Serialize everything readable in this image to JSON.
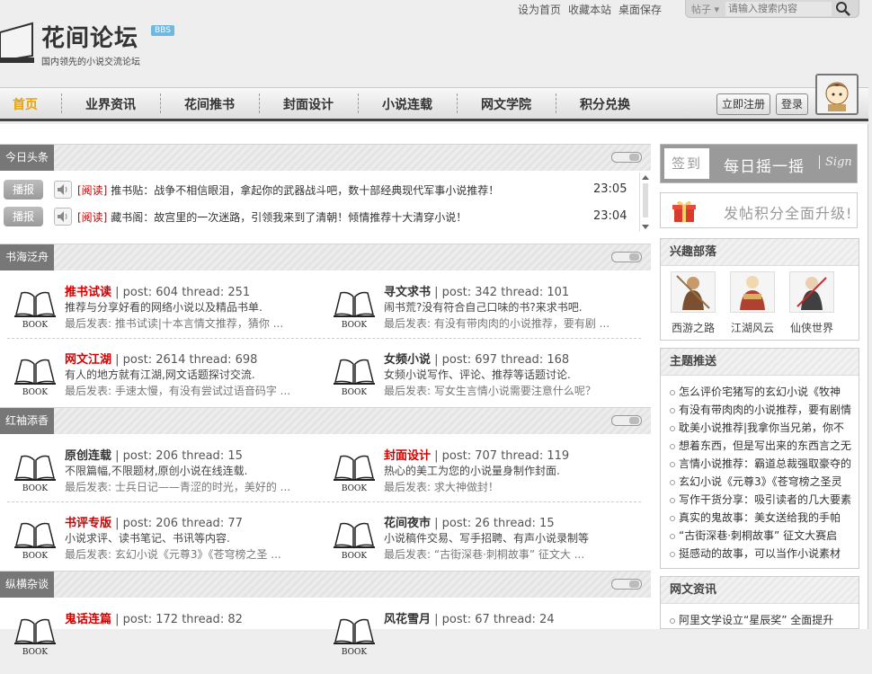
{
  "top_links": [
    "设为首页",
    "收藏本站",
    "桌面保存"
  ],
  "search": {
    "select_label": "帖子",
    "placeholder": "请输入搜索内容"
  },
  "logo": {
    "title": "花间论坛",
    "badge": "BBS",
    "subtitle": "国内领先的小说交流论坛"
  },
  "nav": {
    "items": [
      "首页",
      "业界资讯",
      "花间推书",
      "封面设计",
      "小说连载",
      "网文学院",
      "积分兑换"
    ],
    "active_index": 0
  },
  "auth": {
    "register": "立即注册",
    "login": "登录"
  },
  "headlines": {
    "title": "今日头条",
    "items": [
      {
        "tag": "播报",
        "label": "[阅读]",
        "text": "推书贴：战争不相信眼泪，拿起你的武器战斗吧，数十部经典现代军事小说推荐！",
        "time": "23:05"
      },
      {
        "tag": "播报",
        "label": "[阅读]",
        "text": "藏书阁：故宫里的一次迷路，引领我来到了清朝！倾情推荐十大清穿小说！",
        "time": "23:04"
      }
    ]
  },
  "sections": [
    {
      "title": "书海泛舟",
      "forums": [
        {
          "name": "推书试读",
          "red": true,
          "stats": "| post: 604 thread: 251",
          "desc": "推荐与分享好看的网络小说以及精品书单.",
          "last": "最后发表: 推书试读|十本言情文推荐，猜你 ..."
        },
        {
          "name": "寻文求书",
          "red": false,
          "stats": "| post: 342 thread: 101",
          "desc": "闹书荒?没有符合自己口味的书?来求书吧.",
          "last": "最后发表: 有没有带肉肉的小说推荐，要有剧 ..."
        },
        {
          "name": "网文江湖",
          "red": true,
          "stats": "| post: 2614 thread: 698",
          "desc": "有人的地方就有江湖,网文话题探讨交流.",
          "last": "最后发表: 手速太慢，有没有尝试过语音码字 ..."
        },
        {
          "name": "女频小说",
          "red": false,
          "stats": "| post: 697 thread: 168",
          "desc": "女频小说写作、评论、推荐等话题讨论.",
          "last": "最后发表: 写女生言情小说需要注意什么呢？"
        }
      ]
    },
    {
      "title": "红袖添香",
      "forums": [
        {
          "name": "原创连载",
          "red": false,
          "stats": "| post: 206 thread: 15",
          "desc": "不限篇幅,不限题材,原创小说在线连载.",
          "last": "最后发表: 士兵日记——青涩的时光，美好的 ..."
        },
        {
          "name": "封面设计",
          "red": true,
          "stats": "| post: 707 thread: 119",
          "desc": "热心的美工为您的小说量身制作封面.",
          "last": "最后发表: 求大神做封！"
        },
        {
          "name": "书评专版",
          "red": true,
          "stats": "| post: 206 thread: 77",
          "desc": "小说求评、读书笔记、书讯等内容.",
          "last": "最后发表: 玄幻小说《元尊3》《苍穹榜之圣 ..."
        },
        {
          "name": "花间夜市",
          "red": false,
          "stats": "| post: 26 thread: 15",
          "desc": "小说稿件交易、写手招聘、有声小说录制等",
          "last": "最后发表: “古街深巷·刺桐故事” 征文大 ..."
        }
      ]
    },
    {
      "title": "纵横杂谈",
      "forums": [
        {
          "name": "鬼话连篇",
          "red": true,
          "stats": "| post: 172 thread: 82",
          "desc": "",
          "last": ""
        },
        {
          "name": "风花雪月",
          "red": false,
          "stats": "| post: 67 thread: 24",
          "desc": "",
          "last": ""
        }
      ]
    }
  ],
  "book_label": "BOOK",
  "sidebar": {
    "signin": {
      "tab": "签到",
      "text": "每日摇一摇",
      "en": "Sign"
    },
    "upgrade": "发帖积分全面升级!",
    "tribes": {
      "title": "兴趣部落",
      "items": [
        "西游之路",
        "江湖风云",
        "仙侠世界"
      ]
    },
    "topics": {
      "title": "主题推送",
      "items": [
        "怎么评价宅猪写的玄幻小说《牧神",
        "有没有带肉肉的小说推荐，要有剧情",
        "耽美小说推荐|我拿你当兄弟，你不",
        "想着东西，但是写出来的东西言之无",
        "言情小说推荐：霸道总裁强取豪夺的",
        "玄幻小说《元尊3》《苍穹榜之圣灵",
        "写作干货分享：吸引读者的几大要素",
        "真实的鬼故事：美女送给我的手帕",
        "“古街深巷·刺桐故事” 征文大赛启",
        "挺感动的故事，可以当作小说素材"
      ]
    },
    "news": {
      "title": "网文资讯",
      "items": [
        "阿里文学设立“星辰奖” 全面提升"
      ]
    }
  }
}
